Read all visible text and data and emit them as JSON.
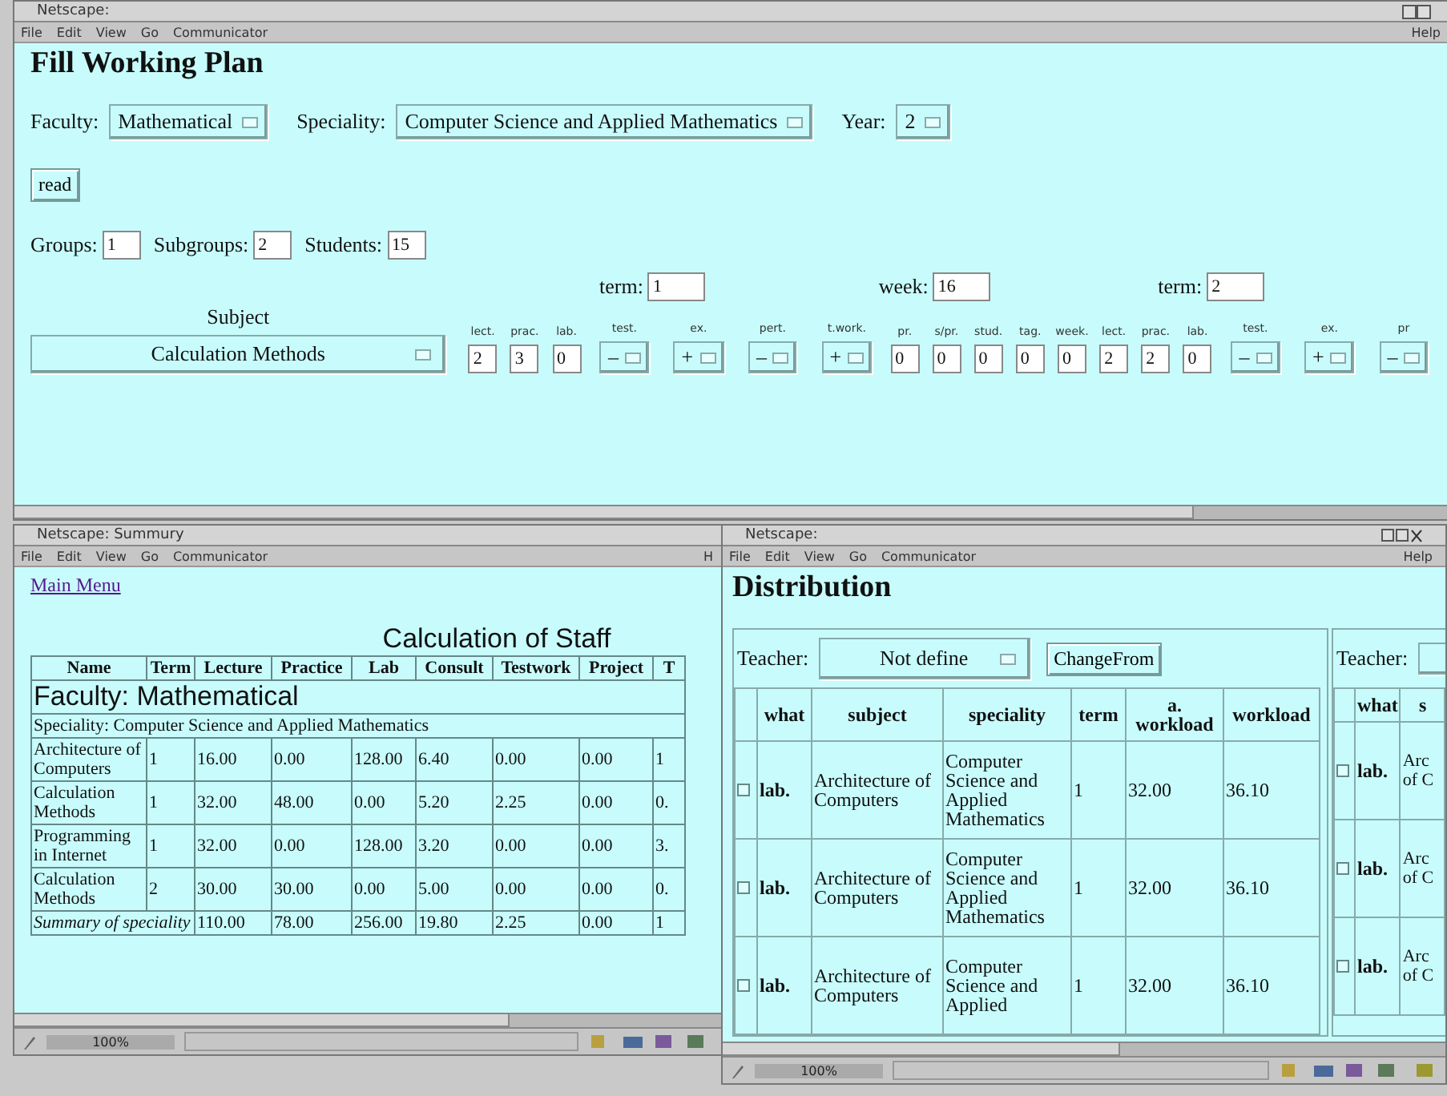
{
  "plan_window": {
    "title": "Netscape:",
    "menu": [
      "File",
      "Edit",
      "View",
      "Go",
      "Communicator"
    ],
    "help": "Help",
    "heading": "Fill Working Plan",
    "selectors": [
      {
        "label": "Faculty:",
        "value": "Mathematical"
      },
      {
        "label": "Speciality:",
        "value": "Computer Science and Applied Mathematics"
      },
      {
        "label": "Year:",
        "value": "2"
      }
    ],
    "read_button": "read",
    "counts": [
      {
        "label": "Groups:",
        "value": "1"
      },
      {
        "label": "Subgroups:",
        "value": "2"
      },
      {
        "label": "Students:",
        "value": "15"
      }
    ],
    "periods": [
      {
        "label": "term:",
        "value": "1"
      },
      {
        "label": "week:",
        "value": "16"
      },
      {
        "label": "term:",
        "value": "2"
      }
    ],
    "subject_label": "Subject",
    "subject_value": "Calculation Methods",
    "columns": [
      {
        "label": "lect.",
        "kind": "input",
        "value": "2"
      },
      {
        "label": "prac.",
        "kind": "input",
        "value": "3"
      },
      {
        "label": "lab.",
        "kind": "input",
        "value": "0"
      },
      {
        "label": "test.",
        "kind": "select",
        "value": "–"
      },
      {
        "label": "ex.",
        "kind": "select",
        "value": "+"
      },
      {
        "label": "pert.",
        "kind": "select",
        "value": "–"
      },
      {
        "label": "t.work.",
        "kind": "select",
        "value": "+"
      },
      {
        "label": "pr.",
        "kind": "input",
        "value": "0"
      },
      {
        "label": "s/pr.",
        "kind": "input",
        "value": "0"
      },
      {
        "label": "stud.",
        "kind": "input",
        "value": "0"
      },
      {
        "label": "tag.",
        "kind": "input",
        "value": "0"
      },
      {
        "label": "week.",
        "kind": "input",
        "value": "0"
      },
      {
        "label": "lect.",
        "kind": "input",
        "value": "2"
      },
      {
        "label": "prac.",
        "kind": "input",
        "value": "2"
      },
      {
        "label": "lab.",
        "kind": "input",
        "value": "0"
      },
      {
        "label": "test.",
        "kind": "select",
        "value": "–"
      },
      {
        "label": "ex.",
        "kind": "select",
        "value": "+"
      },
      {
        "label": "pr",
        "kind": "select",
        "value": "–"
      }
    ]
  },
  "summary_window": {
    "title": "Netscape: Summury",
    "menu": [
      "File",
      "Edit",
      "View",
      "Go",
      "Communicator"
    ],
    "help": "H",
    "link": "Main Menu",
    "caption": "Calculation of Staff",
    "headers": [
      "Name",
      "Term",
      "Lecture",
      "Practice",
      "Lab",
      "Consult",
      "Testwork",
      "Project",
      "T"
    ],
    "faculty": "Faculty: Mathematical",
    "speciality": "Speciality: Computer Science and Applied Mathematics",
    "rows": [
      [
        "Architecture of Computers",
        "1",
        "16.00",
        "0.00",
        "128.00",
        "6.40",
        "0.00",
        "0.00",
        "1"
      ],
      [
        "Calculation Methods",
        "1",
        "32.00",
        "48.00",
        "0.00",
        "5.20",
        "2.25",
        "0.00",
        "0."
      ],
      [
        "Programming in Internet",
        "1",
        "32.00",
        "0.00",
        "128.00",
        "3.20",
        "0.00",
        "0.00",
        "3."
      ],
      [
        "Calculation Methods",
        "2",
        "30.00",
        "30.00",
        "0.00",
        "5.00",
        "0.00",
        "0.00",
        "0."
      ]
    ],
    "summary": {
      "label": "Summary of speciality",
      "cells": [
        "110.00",
        "78.00",
        "256.00",
        "19.80",
        "2.25",
        "0.00",
        "1"
      ]
    },
    "zoom": "100%"
  },
  "distribution_window": {
    "title": "Netscape:",
    "menu": [
      "File",
      "Edit",
      "View",
      "Go",
      "Communicator"
    ],
    "help": "Help",
    "heading": "Distribution",
    "teacher_label": "Teacher:",
    "teacher_value": "Not define",
    "change_button": "ChangeFrom",
    "teacher_label_2": "Teacher:",
    "headers": [
      "what",
      "subject",
      "speciality",
      "term",
      "a. workload",
      "workload"
    ],
    "headers_2": [
      "what",
      "s"
    ],
    "rows": [
      {
        "checked": false,
        "what": "lab.",
        "subject": "Architecture of Computers",
        "speciality": "Computer Science and Applied Mathematics",
        "term": "1",
        "a_workload": "32.00",
        "workload": "36.10",
        "checked_2": false,
        "what_2": "lab.",
        "subject_2": "Arc of C"
      },
      {
        "checked": false,
        "what": "lab.",
        "subject": "Architecture of Computers",
        "speciality": "Computer Science and Applied Mathematics",
        "term": "1",
        "a_workload": "32.00",
        "workload": "36.10",
        "checked_2": false,
        "what_2": "lab.",
        "subject_2": "Arc of C"
      },
      {
        "checked": false,
        "what": "lab.",
        "subject": "Architecture of Computers",
        "speciality": "Computer Science and Applied",
        "term": "1",
        "a_workload": "32.00",
        "workload": "36.10",
        "checked_2": false,
        "what_2": "lab.",
        "subject_2": "Arc of C"
      }
    ],
    "zoom": "100%"
  }
}
